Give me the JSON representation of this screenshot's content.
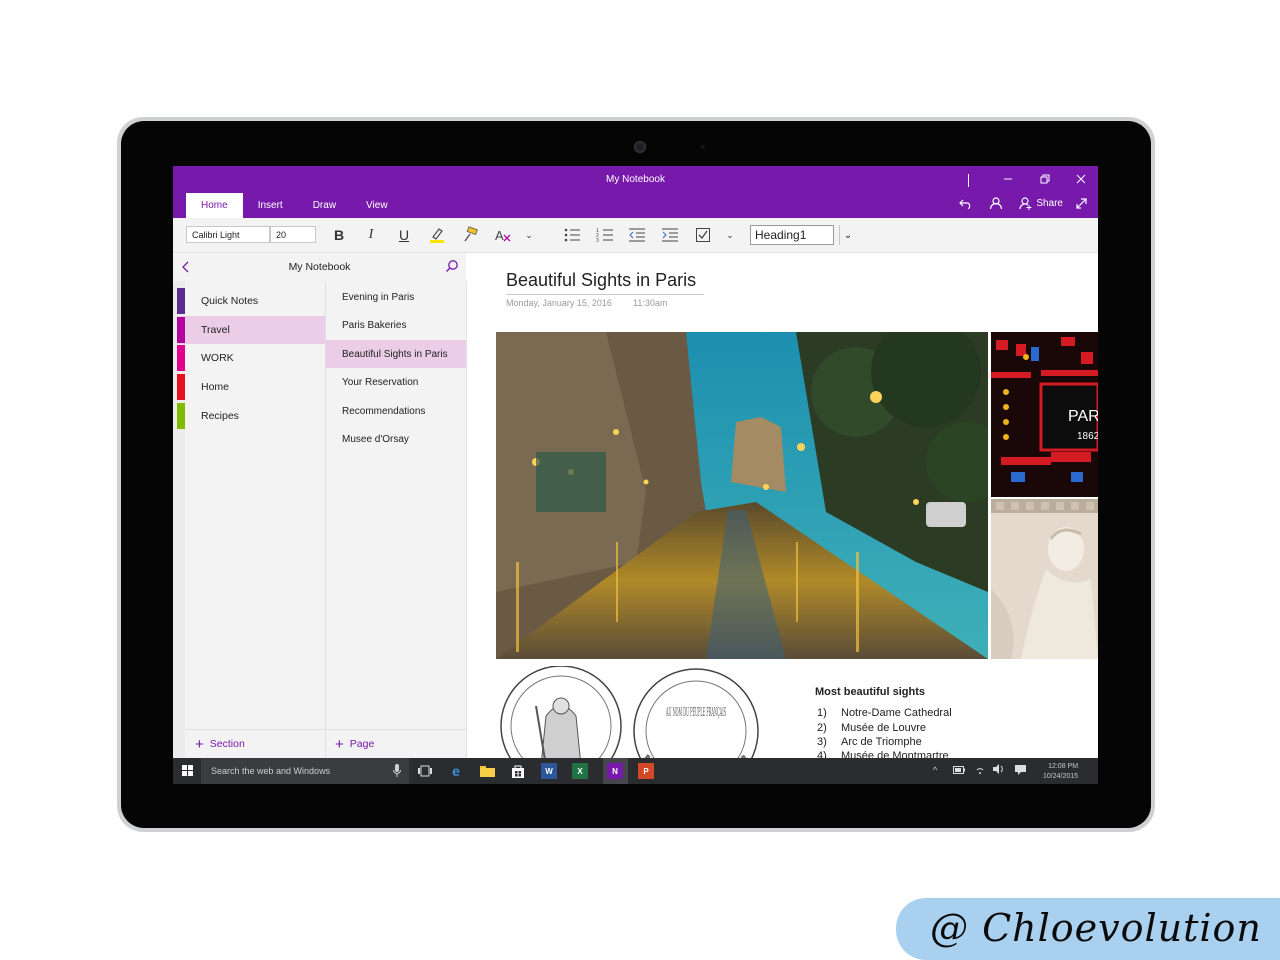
{
  "app": {
    "title": "My Notebook",
    "accent_color": "#7719aa",
    "selection_color": "#ebcde8"
  },
  "window_controls": [
    "minimize-icon",
    "restore-icon",
    "close-icon"
  ],
  "ribbon": {
    "tabs": [
      {
        "label": "Home",
        "active": true
      },
      {
        "label": "Insert",
        "active": false
      },
      {
        "label": "Draw",
        "active": false
      },
      {
        "label": "View",
        "active": false
      }
    ],
    "share_label": "Share"
  },
  "toolbar": {
    "font_name": "Calibri Light",
    "font_size": "20",
    "style": "Heading1",
    "buttons": [
      "bold-icon",
      "italic-icon",
      "underline-icon",
      "highlight-icon",
      "format-painter-icon",
      "text-style-icon",
      "chevron-down-icon",
      "bullets-icon",
      "numbering-icon",
      "outdent-icon",
      "indent-icon",
      "todo-checkbox-icon",
      "chevron-down-icon"
    ]
  },
  "nav": {
    "notebook_title": "My Notebook",
    "sections": [
      {
        "label": "Quick Notes",
        "color": "#5a2d91",
        "active": false
      },
      {
        "label": "Travel",
        "color": "#b4009e",
        "active": true
      },
      {
        "label": "WORK",
        "color": "#e3008c",
        "active": false
      },
      {
        "label": "Home",
        "color": "#e81123",
        "active": false
      },
      {
        "label": "Recipes",
        "color": "#7fba00",
        "active": false
      }
    ],
    "pages": [
      {
        "label": "Evening in Paris",
        "active": false
      },
      {
        "label": "Paris Bakeries",
        "active": false
      },
      {
        "label": "Beautiful Sights in Paris",
        "active": true
      },
      {
        "label": "Your Reservation",
        "active": false
      },
      {
        "label": "Recommendations",
        "active": false
      },
      {
        "label": "Musee d'Orsay",
        "active": false
      }
    ],
    "add_section_label": "Section",
    "add_page_label": "Page"
  },
  "page": {
    "title": "Beautiful Sights in Paris",
    "date": "Monday, January 15, 2016",
    "time": "11:30am",
    "stained_glass_text": "PARI",
    "stained_glass_year": "1862",
    "coin_text": "AU NOM DU PEUPLE FRANÇAIS",
    "sights_title": "Most beautiful sights",
    "sights": [
      {
        "num": "1)",
        "name": "Notre-Dame Cathedral"
      },
      {
        "num": "2)",
        "name": "Musée de Louvre"
      },
      {
        "num": "3)",
        "name": "Arc de Triomphe"
      },
      {
        "num": "4)",
        "name": "Musée de Montmartre"
      }
    ]
  },
  "taskbar": {
    "search_placeholder": "Search the web and Windows",
    "apps": [
      "task-view-icon",
      "edge-icon",
      "file-explorer-icon",
      "store-icon",
      "word-icon",
      "excel-icon",
      "onenote-icon",
      "powerpoint-icon"
    ],
    "time": "12:08 PM",
    "date": "10/24/2015"
  },
  "watermark": "@ Chloevolution"
}
